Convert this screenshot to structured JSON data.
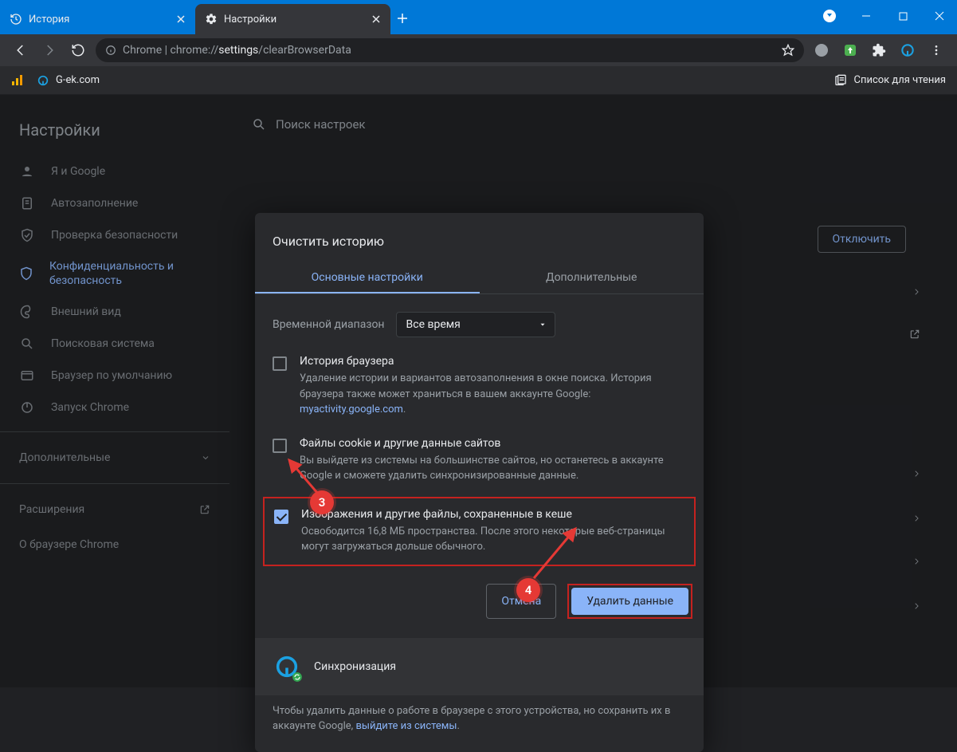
{
  "titlebar": {
    "tabs": [
      {
        "label": "История",
        "icon": "history-icon"
      },
      {
        "label": "Настройки",
        "icon": "gear-icon"
      }
    ]
  },
  "urlbar": {
    "prefix": "Chrome",
    "separator": " | ",
    "url_scheme": "chrome://",
    "url_strong": "settings",
    "url_rest": "/clearBrowserData"
  },
  "bookmarks": {
    "items": [
      {
        "label": "G-ek.com"
      }
    ],
    "analytics_icon": "analytics-icon",
    "reading_list": "Список для чтения"
  },
  "sidebar": {
    "title": "Настройки",
    "items": [
      {
        "label": "Я и Google",
        "icon": "person-icon"
      },
      {
        "label": "Автозаполнение",
        "icon": "clipboard-icon"
      },
      {
        "label": "Проверка безопасности",
        "icon": "shield-check-icon"
      },
      {
        "label": "Конфиденциальность и безопасность",
        "icon": "shield-icon"
      },
      {
        "label": "Внешний вид",
        "icon": "palette-icon"
      },
      {
        "label": "Поисковая система",
        "icon": "search-icon"
      },
      {
        "label": "Браузер по умолчанию",
        "icon": "window-icon"
      },
      {
        "label": "Запуск Chrome",
        "icon": "power-icon"
      }
    ],
    "more": "Дополнительные",
    "extensions": "Расширения",
    "about": "О браузере Chrome"
  },
  "content": {
    "search_placeholder": "Поиск настроек",
    "disable_button": "Отключить"
  },
  "modal": {
    "title": "Очистить историю",
    "tab_basic": "Основные настройки",
    "tab_advanced": "Дополнительные",
    "range_label": "Временной диапазон",
    "range_value": "Все время",
    "items": [
      {
        "title": "История браузера",
        "body_a": "Удаление истории и вариантов автозаполнения в окне поиска. История браузера также может храниться в вашем аккаунте Google: ",
        "link": "myactivity.google.com",
        "body_b": ".",
        "checked": false
      },
      {
        "title": "Файлы cookie и другие данные сайтов",
        "body_a": "Вы выйдете из системы на большинстве сайтов, но останетесь в аккаунте Google и сможете удалить синхронизированные данные.",
        "link": "",
        "body_b": "",
        "checked": false
      },
      {
        "title": "Изображения и другие файлы, сохраненные в кеше",
        "body_a": "Освободится 16,8 МБ пространства. После этого некоторые веб-страницы могут загружаться дольше обычного.",
        "link": "",
        "body_b": "",
        "checked": true
      }
    ],
    "cancel": "Отмена",
    "confirm": "Удалить данные",
    "sync_title": "Синхронизация",
    "sync_desc_a": "Чтобы удалить данные о работе в браузере с этого устройства, но сохранить их в аккаунте Google, ",
    "sync_link": "выйдите из системы",
    "sync_desc_b": "."
  },
  "callouts": {
    "c3": "3",
    "c4": "4"
  }
}
